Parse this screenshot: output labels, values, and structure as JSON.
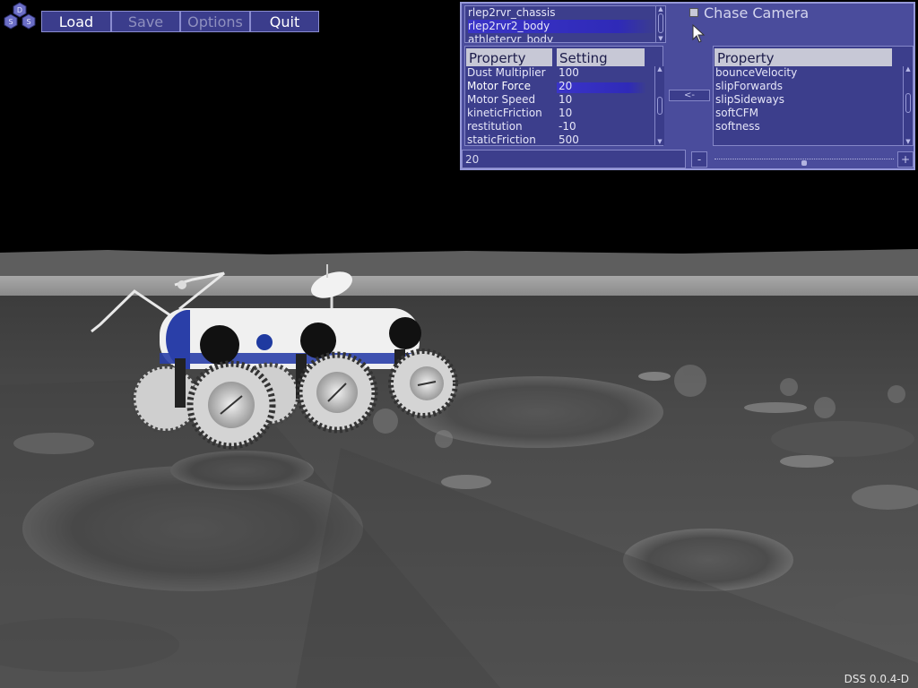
{
  "toolbar": {
    "logo_letters": [
      "D",
      "S",
      "S"
    ],
    "load_label": "Load",
    "save_label": "Save",
    "options_label": "Options",
    "quit_label": "Quit"
  },
  "panel": {
    "body_list": [
      "rlep2rvr_chassis",
      "rlep2rvr2_body",
      "athleteryr_body"
    ],
    "selected_body_index": 1,
    "chase_camera_label": "Chase Camera",
    "chase_camera_checked": false,
    "left_table": {
      "header_property": "Property",
      "header_setting": "Setting",
      "rows": [
        {
          "property": "Dust Multiplier",
          "setting": "100"
        },
        {
          "property": "Motor Force",
          "setting": "20"
        },
        {
          "property": "Motor Speed",
          "setting": "10"
        },
        {
          "property": "kineticFriction",
          "setting": "10"
        },
        {
          "property": "restitution",
          "setting": "-10"
        },
        {
          "property": "staticFriction",
          "setting": "500"
        }
      ],
      "selected_row_index": 1
    },
    "move_button_label": "<-",
    "right_table": {
      "header_property": "Property",
      "rows": [
        "bounceVelocity",
        "slipForwards",
        "slipSideways",
        "softCFM",
        "softness"
      ]
    },
    "value_field": "20",
    "minus_label": "-",
    "plus_label": "+",
    "slider_level": 0.5
  },
  "footer": {
    "version": "DSS 0.0.4-D"
  },
  "colors": {
    "ui_panel": "#4a4c9c",
    "ui_border": "#9698d8",
    "selection": "#3a34c8",
    "rover_blue": "#2a3fa8"
  }
}
